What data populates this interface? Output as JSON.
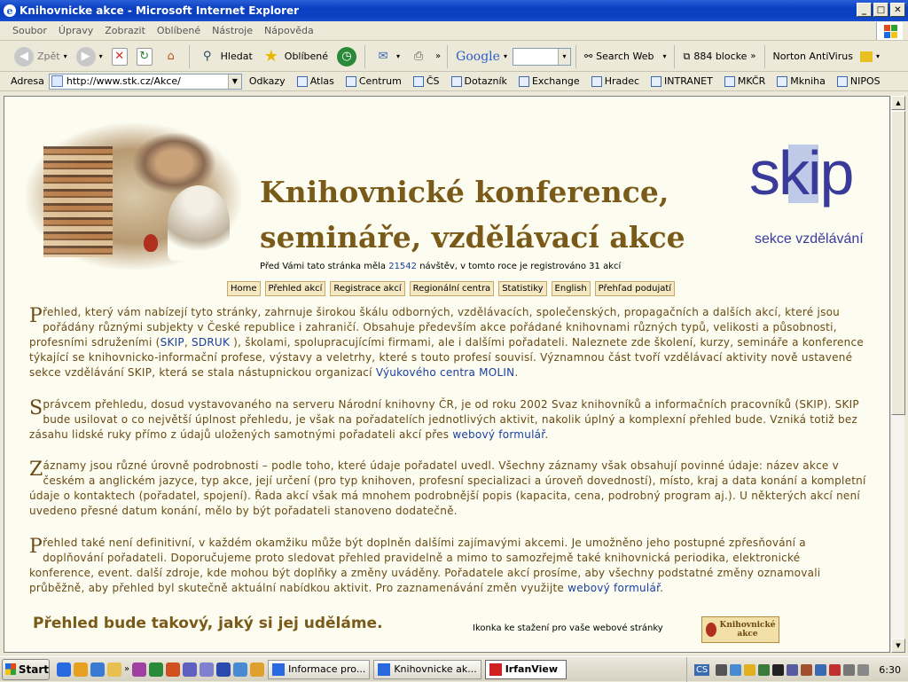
{
  "window": {
    "title": "Knihovnicke akce - Microsoft Internet Explorer"
  },
  "menu": [
    "Soubor",
    "Úpravy",
    "Zobrazit",
    "Oblíbené",
    "Nástroje",
    "Nápověda"
  ],
  "toolbar": {
    "back": "Zpět",
    "search": "Hledat",
    "favorites": "Oblíbené",
    "google": "Google",
    "search_web": "Search Web",
    "popup": "884 blocke",
    "norton": "Norton AntiVirus"
  },
  "address": {
    "label": "Adresa",
    "url": "http://www.stk.cz/Akce/"
  },
  "links": {
    "label": "Odkazy",
    "items": [
      "Atlas",
      "Centrum",
      "ČS",
      "Dotazník",
      "Exchange",
      "Hradec",
      "INTRANET",
      "MKČR",
      "Mkniha",
      "NIPOS"
    ]
  },
  "page": {
    "title_line1": "Knihovnické konference,",
    "title_line2": "semináře, vzdělávací akce",
    "logo": "skip",
    "logo_sub": "sekce vzdělávání",
    "visits_prefix": "Před Vámi tato stránka měla",
    "visits_count": "21542",
    "visits_suffix": "návštěv, v tomto roce je registrováno 31 akcí",
    "nav": [
      "Home",
      "Přehled akcí",
      "Registrace akcí",
      "Regionální centra",
      "Statistiky",
      "English",
      "Přehľad podujatí"
    ],
    "p1": {
      "cap": "P",
      "text1": "řehled, který vám nabízejí tyto stránky, zahrnuje širokou škálu odborných, vzdělávacích, společenských, propagačních a dalších akcí, které jsou pořádány různými subjekty v České republice i zahraničí. Obsahuje především akce pořádané knihovnami různých typů, velikosti a působnosti, profesními sdruženími (",
      "link1": "SKIP",
      "sep": ", ",
      "link2": "SDRUK",
      "text2": " ), školami, spolupracujícími firmami, ale i dalšími pořadateli. Naleznete zde školení, kurzy, semináře a konference týkající se knihovnicko-informační profese, výstavy a veletrhy, které s touto profesí souvisí. Významnou část tvoří vzdělávací aktivity nově ustavené sekce vzdělávání SKIP, která se stala nástupnickou organizací ",
      "link3": "Výukového centra MOLIN",
      "text3": "."
    },
    "p2": {
      "cap": "S",
      "text1": "právcem přehledu, dosud vystavovaného na serveru Národní knihovny ČR, je od roku 2002 Svaz knihovníků a informačních pracovníků (SKIP). SKIP bude usilovat o co největší úplnost přehledu, je však na pořadatelích jednotlivých aktivit, nakolik úplný a komplexní přehled bude. Vzniká totiž bez zásahu lidské ruky přímo z údajů uložených samotnými pořadateli akcí přes ",
      "link": "webový formulář",
      "text2": "."
    },
    "p3": {
      "cap": "Z",
      "text": "áznamy jsou různé úrovně podrobnosti – podle toho, které údaje pořadatel uvedl. Všechny záznamy však obsahují povinné údaje: název akce v českém a anglickém jazyce, typ akce, její určení (pro typ knihoven, profesní specializaci a úroveň dovedností), místo, kraj a data konání a kompletní údaje o kontaktech (pořadatel, spojení). Řada akcí však má mnohem podrobnější popis (kapacita, cena, podrobný program aj.). U některých akcí není uvedeno přesné datum konání, mělo by být pořadateli stanoveno dodatečně."
    },
    "p4": {
      "cap": "P",
      "text1": "řehled také není definitivní, v každém okamžiku může být doplněn dalšími zajímavými akcemi. Je umožněno jeho postupné zpřesňování a doplňování pořadateli. Doporučujeme proto sledovat přehled pravidelně a mimo to samozřejmě také knihovnická periodika, elektronické konference, event. další zdroje, kde mohou být doplňky a změny uváděny. Pořadatele akcí prosíme, aby všechny podstatné změny oznamovali průběžně, aby přehled byl skutečně aktuální nabídkou aktivit. Pro zaznamenávání změn využijte ",
      "link": "webový formulář",
      "text2": "."
    },
    "slogan": "Přehled bude takový, jaký si jej uděláme.",
    "download_label": "Ikonka ke stažení pro vaše webové stránky",
    "download_btn_line1": "Knihovnické",
    "download_btn_line2": "akce"
  },
  "taskbar": {
    "start": "Start",
    "tasks": [
      "Informace pro...",
      "Knihovnicke ak...",
      "IrfanView"
    ],
    "lang": "CS",
    "clock": "6:30"
  }
}
